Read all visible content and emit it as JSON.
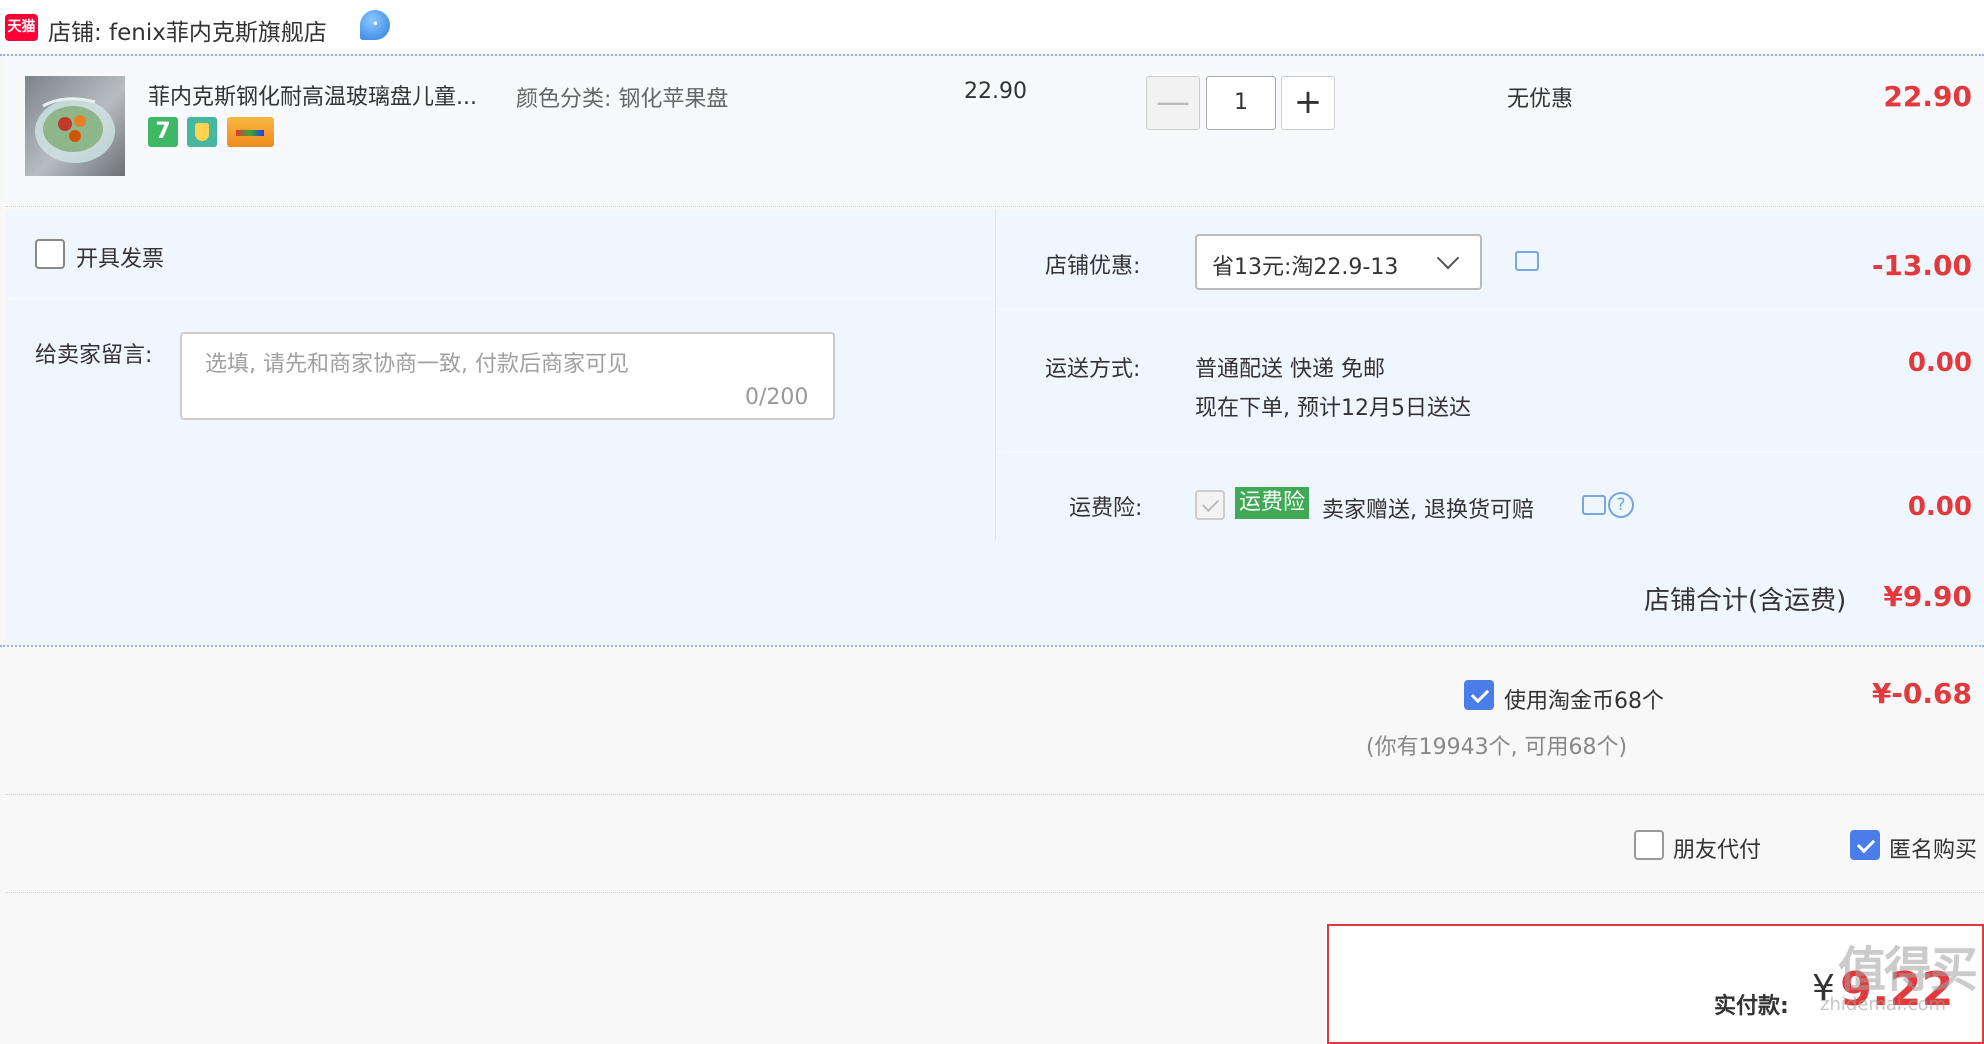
{
  "store": {
    "logo_text": "天猫",
    "label": "店铺: fenix菲内克斯旗舰店"
  },
  "item": {
    "title": "菲内克斯钢化耐高温玻璃盘儿童...",
    "spec": "颜色分类: 钢化苹果盘",
    "badge_7": "7",
    "unit_price": "22.90",
    "quantity": "1",
    "minus": "—",
    "plus": "+",
    "discount": "无优惠",
    "total": "22.90"
  },
  "invoice": {
    "label": "开具发票",
    "checked": false
  },
  "message": {
    "label": "给卖家留言:",
    "placeholder": "选填, 请先和商家协商一致, 付款后商家可见",
    "count": "0/200"
  },
  "coupon": {
    "label": "店铺优惠:",
    "selected": "省13元:淘22.9-13",
    "amount": "-13.00"
  },
  "shipping": {
    "label": "运送方式:",
    "method": "普通配送 快递 免邮",
    "eta": "现在下单, 预计12月5日送达",
    "amount": "0.00"
  },
  "insurance": {
    "label": "运费险:",
    "tag": "运费险",
    "text": "卖家赠送, 退换货可赔",
    "help": "?",
    "amount": "0.00"
  },
  "store_total": {
    "label": "店铺合计(含运费)",
    "amount": "¥9.90"
  },
  "coins": {
    "label": "使用淘金币68个",
    "note": "(你有19943个, 可用68个)",
    "amount": "¥-0.68",
    "checked": true
  },
  "payment_options": {
    "friend_pay": "朋友代付",
    "anonymous": "匿名购买",
    "anonymous_checked": true
  },
  "payment": {
    "label": "实付款:",
    "currency": "¥",
    "amount": "9.22"
  },
  "watermark": {
    "main": "值得买",
    "sub": "zhidemai.com"
  },
  "colors": {
    "accent_red": "#e4393c",
    "checkbox_blue": "#4a7de8",
    "tmall_red": "#ff0036",
    "insurance_green": "#3fa956"
  }
}
